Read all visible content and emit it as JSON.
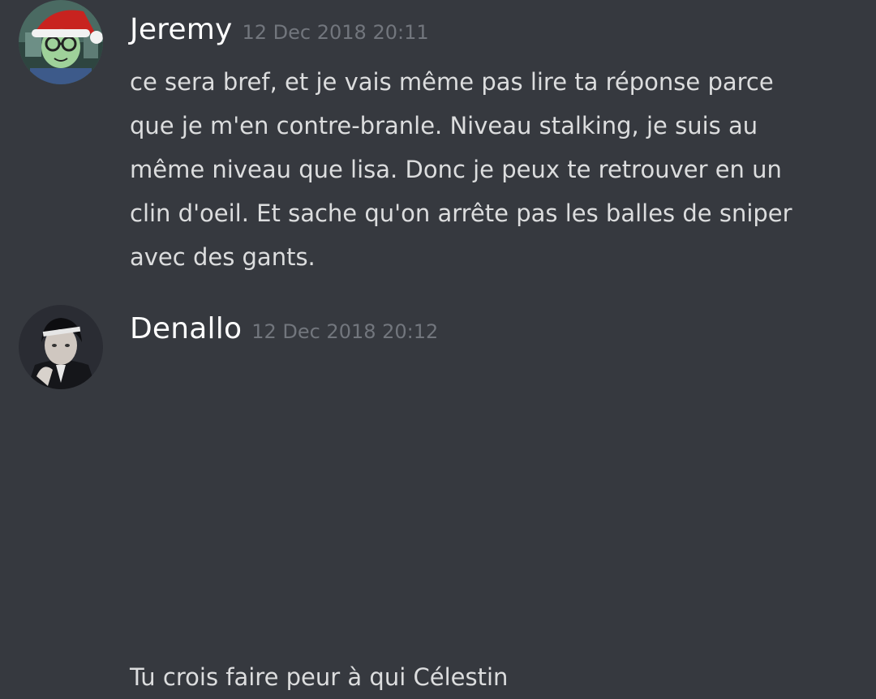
{
  "messages": [
    {
      "author": "Jeremy",
      "timestamp": "12 Dec 2018 20:11",
      "text": "ce sera bref, et je vais même pas lire ta réponse parce\nque je m'en contre-branle. Niveau stalking, je suis au\nmême niveau que lisa. Donc je peux te retrouver en un\nclin d'oeil. Et sache qu'on arrête pas les balles de sniper\navec des gants.",
      "avatar": "santa-hat-avatar"
    },
    {
      "author": "Denallo",
      "timestamp": "12 Dec 2018 20:12",
      "text": "Tu crois faire peur à qui Célestin",
      "avatar": "anime-character-avatar"
    }
  ],
  "colors": {
    "background": "#36393f",
    "username": "#ffffff",
    "timestamp": "#72767d",
    "text": "#dcddde"
  }
}
